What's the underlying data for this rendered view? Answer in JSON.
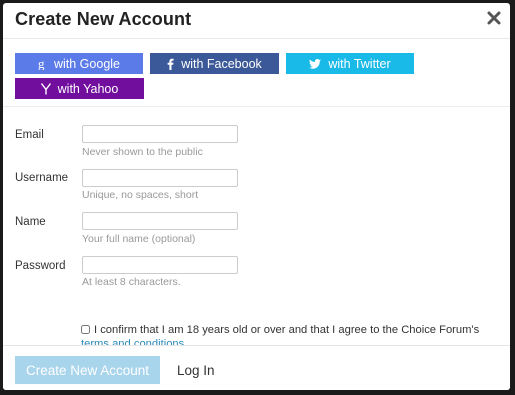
{
  "header": {
    "title": "Create New Account",
    "close_icon": "close-icon"
  },
  "social": {
    "google": {
      "label": "with Google",
      "icon": "google-icon",
      "color": "#5b7be8"
    },
    "facebook": {
      "label": "with Facebook",
      "icon": "facebook-icon",
      "color": "#3b5998"
    },
    "twitter": {
      "label": "with Twitter",
      "icon": "twitter-icon",
      "color": "#19b9e8"
    },
    "yahoo": {
      "label": "with Yahoo",
      "icon": "yahoo-icon",
      "color": "#720e9e"
    }
  },
  "form": {
    "email": {
      "label": "Email",
      "value": "",
      "hint": "Never shown to the public"
    },
    "username": {
      "label": "Username",
      "value": "",
      "hint": "Unique, no spaces, short"
    },
    "name": {
      "label": "Name",
      "value": "",
      "hint": "Your full name (optional)"
    },
    "password": {
      "label": "Password",
      "value": "",
      "hint": "At least 8 characters."
    },
    "confirm": {
      "checked": false,
      "text": "I confirm that I am 18 years old or over and that I agree to the Choice Forum's ",
      "link_text": "terms and conditions"
    }
  },
  "footer": {
    "create_label": "Create New Account",
    "login_label": "Log In"
  },
  "colors": {
    "create_button_disabled": "#a8d4ec",
    "link": "#2a8ab8"
  }
}
